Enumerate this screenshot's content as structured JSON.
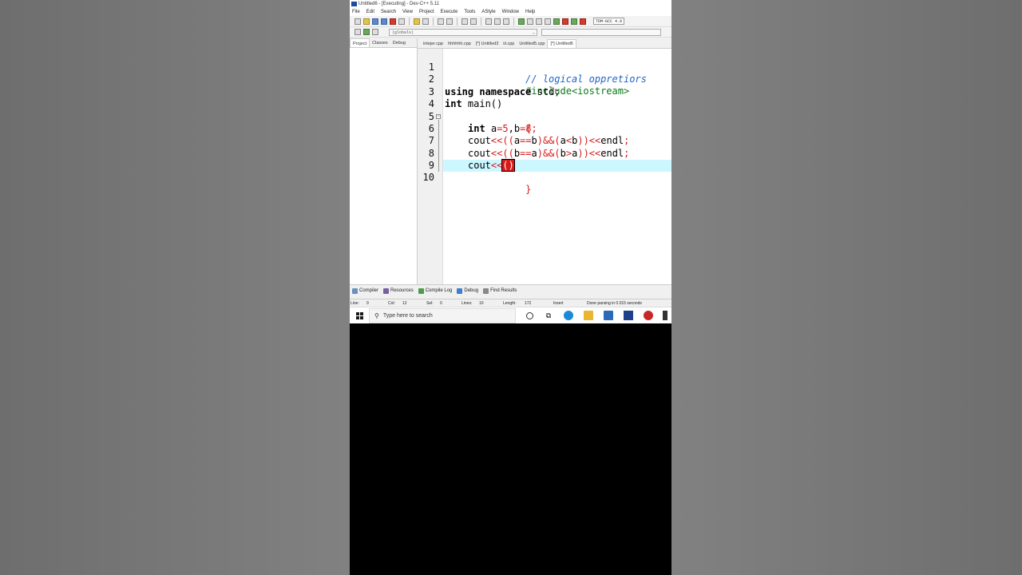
{
  "window": {
    "title": "Untitled6 - [Executing] - Dev-C++ 5.11"
  },
  "menu": [
    "File",
    "Edit",
    "Search",
    "View",
    "Project",
    "Execute",
    "Tools",
    "AStyle",
    "Window",
    "Help"
  ],
  "toolbar": {
    "compiler": "TDM-GCC 4.9"
  },
  "scope": {
    "value": "(globals)"
  },
  "left_panel": {
    "tabs": [
      "Project",
      "Classes",
      "Debug"
    ]
  },
  "file_tabs": [
    "intejer.cpp",
    "hhhhhh.cpp",
    "[*] Untitled3",
    "iii.cpp",
    "Untitled5.cpp",
    "[*] Untitled6"
  ],
  "editor": {
    "line_numbers": [
      "1",
      "2",
      "3",
      "4",
      "5",
      "6",
      "7",
      "8",
      "9",
      "10"
    ],
    "code": {
      "l1": "// logical oppretiors",
      "l2": "#include<iostream>",
      "l3_kw1": "using",
      "l3_kw2": "namespace",
      "l3_rest": " std;",
      "l4_kw": "int",
      "l4_rest": " main()",
      "l5": "{",
      "l6_kw": "int",
      "l6_a": " a",
      "l6_eq1": "=",
      "l6_5": "5",
      "l6_comma": ",b",
      "l6_eq2": "=",
      "l6_8": "8",
      "l6_semi": ";",
      "l7_cout": "cout",
      "l7_op1": "<<((",
      "l7_a": "a",
      "l7_eqeq": "==",
      "l7_b": "b",
      "l7_op2": ")&&(",
      "l7_a2": "a",
      "l7_lt": "<",
      "l7_b2": "b",
      "l7_op3": "))<<",
      "l7_endl": "endl",
      "l7_semi": ";",
      "l8_cout": "cout",
      "l8_op1": "<<((",
      "l8_b": "b",
      "l8_eqeq": "==",
      "l8_a": "a",
      "l8_op2": ")&&(",
      "l8_b2": "b",
      "l8_gt": ">",
      "l8_a2": "a",
      "l8_op3": "))<<",
      "l8_endl": "endl",
      "l8_semi": ";",
      "l9_cout": "cout",
      "l9_op": "<<",
      "l9_paren": "()",
      "l10": "}"
    }
  },
  "bottom_tabs": [
    "Compiler",
    "Resources",
    "Compile Log",
    "Debug",
    "Find Results"
  ],
  "status": {
    "line_label": "Line:",
    "line_val": "9",
    "col_label": "Col:",
    "col_val": "12",
    "sel_label": "Sel:",
    "sel_val": "0",
    "lines_label": "Lines:",
    "lines_val": "10",
    "length_label": "Length:",
    "length_val": "172",
    "mode": "Insert",
    "message": "Done parsing in 0.015 seconds"
  },
  "taskbar": {
    "search_placeholder": "Type here to search"
  },
  "colors": {
    "comment": "#1f66c8",
    "preprocessor": "#0a7a1a",
    "operator": "#d81a1a",
    "active_line": "#ccf7ff"
  }
}
